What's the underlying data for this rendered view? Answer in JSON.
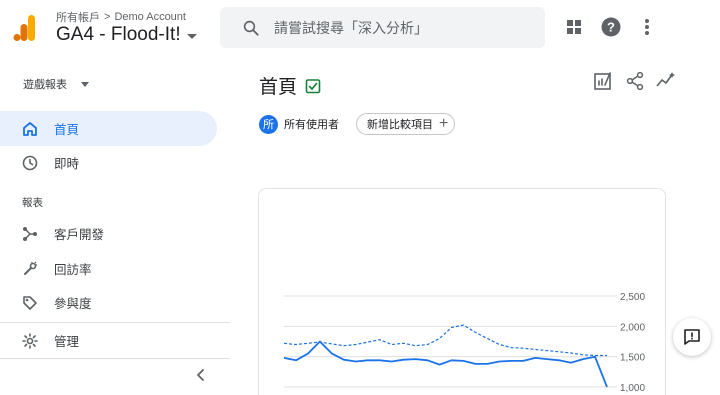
{
  "header": {
    "breadcrumb_accounts": "所有帳戶",
    "breadcrumb_separator": ">",
    "breadcrumb_account": "Demo Account",
    "property_name": "GA4 - Flood-It!",
    "search_placeholder": "請嘗試搜尋「深入分析」",
    "icons": [
      "analytics-logo",
      "search-icon",
      "apps-grid-icon",
      "help-icon",
      "more-vert-icon"
    ]
  },
  "sidebar": {
    "collection_label": "遊戲報表",
    "section_label": "報表",
    "items": [
      {
        "label": "首頁",
        "icon": "home-icon",
        "active": true
      },
      {
        "label": "即時",
        "icon": "clock-icon",
        "active": false
      },
      {
        "label": "客戶開發",
        "icon": "acquisition-icon",
        "active": false
      },
      {
        "label": "回訪率",
        "icon": "retention-icon",
        "active": false
      },
      {
        "label": "參與度",
        "icon": "tag-icon",
        "active": false
      },
      {
        "label": "管理",
        "icon": "gear-icon",
        "active": false
      }
    ]
  },
  "main": {
    "title": "首頁",
    "segment_badge": "所",
    "segment_label": "所有使用者",
    "add_comparison_label": "新增比較項目",
    "add_symbol": "+"
  },
  "colors": {
    "accent": "#1a73e8",
    "active_bg": "#e8f0fe",
    "logo_dark": "#e37400",
    "logo_light": "#f9ab00"
  },
  "chart_data": {
    "type": "line",
    "y_ticks": [
      "2,500",
      "2,000",
      "1,500",
      "1,000"
    ],
    "ylim": [
      1000,
      2500
    ],
    "grid": true,
    "series": [
      {
        "style": "solid",
        "values": [
          1480,
          1440,
          1550,
          1750,
          1550,
          1450,
          1420,
          1440,
          1440,
          1420,
          1450,
          1460,
          1440,
          1370,
          1440,
          1430,
          1380,
          1380,
          1420,
          1430,
          1430,
          1480,
          1460,
          1440,
          1400,
          1460,
          1500,
          1000
        ]
      },
      {
        "style": "dashed",
        "values": [
          1720,
          1700,
          1720,
          1740,
          1710,
          1680,
          1700,
          1740,
          1780,
          1700,
          1720,
          1680,
          1700,
          1800,
          1980,
          2020,
          1900,
          1800,
          1700,
          1650,
          1640,
          1620,
          1600,
          1580,
          1560,
          1530,
          1520,
          1520
        ]
      }
    ]
  }
}
